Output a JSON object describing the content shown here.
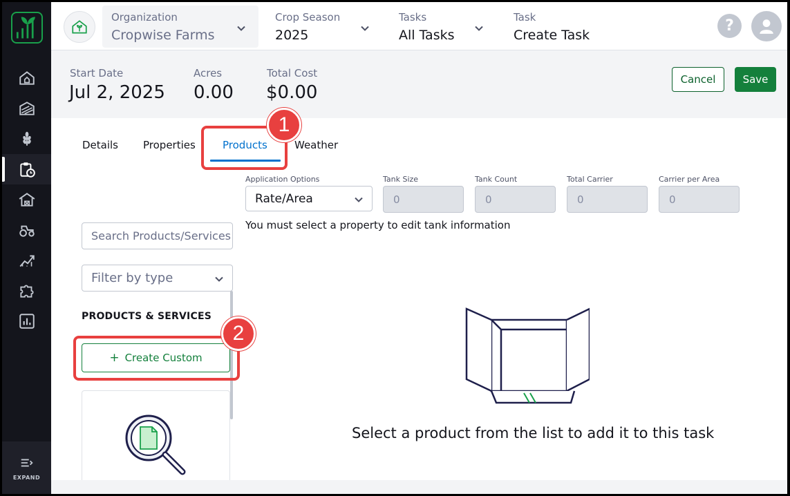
{
  "header": {
    "organization": {
      "label": "Organization",
      "value": "Cropwise Farms"
    },
    "crop_season": {
      "label": "Crop Season",
      "value": "2025"
    },
    "tasks": {
      "label": "Tasks",
      "value": "All Tasks"
    },
    "task": {
      "label": "Task",
      "value": "Create Task"
    },
    "help": "?"
  },
  "summary": {
    "start_date": {
      "label": "Start Date",
      "value": "Jul 2, 2025"
    },
    "acres": {
      "label": "Acres",
      "value": "0.00"
    },
    "total_cost": {
      "label": "Total Cost",
      "value": "$0.00"
    },
    "cancel_label": "Cancel",
    "save_label": "Save"
  },
  "tabs": [
    {
      "label": "Details"
    },
    {
      "label": "Properties"
    },
    {
      "label": "Products",
      "active": true
    },
    {
      "label": "Weather"
    }
  ],
  "left_panel": {
    "search_placeholder": "Search Products/Services",
    "filter_placeholder": "Filter by type",
    "heading": "PRODUCTS & SERVICES",
    "create_custom_label": "Create Custom",
    "create_custom_icon": "+"
  },
  "application": {
    "options_label": "Application Options",
    "options_value": "Rate/Area",
    "tank_size": {
      "label": "Tank Size",
      "value": "0"
    },
    "tank_count": {
      "label": "Tank Count",
      "value": "0"
    },
    "total_carrier": {
      "label": "Total Carrier",
      "value": "0"
    },
    "carrier_per_area": {
      "label": "Carrier per Area",
      "value": "0"
    },
    "tank_info": "You must select a property to edit tank information"
  },
  "empty_state": {
    "message": "Select a product from the list to add it to this task"
  },
  "sidebar": {
    "expand_label": "EXPAND",
    "items": [
      {
        "icon": "home-icon"
      },
      {
        "icon": "field-icon"
      },
      {
        "icon": "crop-icon"
      },
      {
        "icon": "clipboard-clock-icon",
        "active": true
      },
      {
        "icon": "barn-icon"
      },
      {
        "icon": "tractor-icon"
      },
      {
        "icon": "growth-chart-icon"
      },
      {
        "icon": "puzzle-icon"
      },
      {
        "icon": "bar-chart-icon"
      }
    ]
  },
  "callouts": [
    "1",
    "2"
  ],
  "colors": {
    "sidebar_bg": "#14151c",
    "brand_green": "#14803c",
    "tab_blue": "#0071cd",
    "callout_red": "#e8403f",
    "summary_bg": "#f3f4f6"
  }
}
